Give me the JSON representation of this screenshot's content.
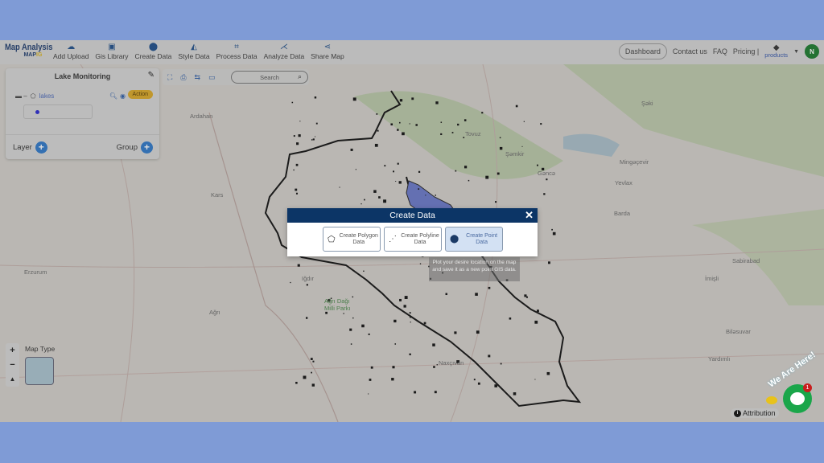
{
  "header": {
    "brand_title": "Map Analysis",
    "brand_sub": "MAP",
    "brand_sub_accent": "IG",
    "nav": [
      {
        "label": "Add Upload",
        "icon": "cloud-upload-icon"
      },
      {
        "label": "Gis Library",
        "icon": "library-icon"
      },
      {
        "label": "Create Data",
        "icon": "map-pin-icon"
      },
      {
        "label": "Style Data",
        "icon": "paint-bucket-icon"
      },
      {
        "label": "Process Data",
        "icon": "process-icon"
      },
      {
        "label": "Analyze Data",
        "icon": "analyze-icon"
      },
      {
        "label": "Share Map",
        "icon": "share-icon"
      }
    ],
    "dashboard": "Dashboard",
    "contact": "Contact us",
    "faq": "FAQ",
    "pricing": "Pricing |",
    "products": "products",
    "avatar": "N"
  },
  "panel": {
    "title": "Lake Monitoring",
    "layer_name": "lakes",
    "action": "Action",
    "layer_label": "Layer",
    "group_label": "Group"
  },
  "toolbar": {
    "search_placeholder": "Search"
  },
  "modal": {
    "title": "Create Data",
    "close": "✕",
    "options": [
      {
        "label": "Create Polygon Data",
        "icon": "polygon-icon"
      },
      {
        "label": "Create Polyline Data",
        "icon": "polyline-icon"
      },
      {
        "label": "Create Point Data",
        "icon": "map-pin-icon",
        "selected": true
      }
    ],
    "tooltip": "Plot your desire location on the map and save it as a new point GIS data."
  },
  "map": {
    "labels": [
      "Erzurum",
      "Ağrı",
      "Kars",
      "Ardahan",
      "Iğdır",
      "Ağrı Dağı Milli Parkı",
      "Naxçıvan",
      "Gəncə",
      "Şəmkir",
      "Tovuz",
      "Mingəçevir",
      "Yevlax",
      "Barda",
      "Şəki",
      "Sabirabad",
      "İmişli",
      "Biləsuvar",
      "Yardımlı"
    ],
    "map_type": "Map Type",
    "attribution": "Attribution",
    "zoom_in": "+",
    "zoom_out": "−"
  },
  "chat": {
    "badge": "1",
    "banner": "We Are Here!"
  },
  "colors": {
    "frame": "#7f9bd6",
    "header_navy": "#0c3566",
    "action": "#d9a826",
    "polygon": "#6a78c8",
    "avatar": "#1a7a2e",
    "chat": "#1aa64a"
  }
}
